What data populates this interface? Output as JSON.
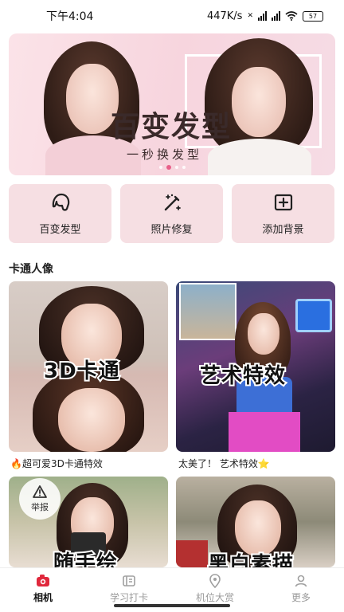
{
  "status_bar": {
    "time": "下午4:04",
    "net_speed": "447K/s",
    "battery": "57"
  },
  "banner": {
    "title": "百变发型",
    "subtitle": "一秒换发型",
    "dots": 4,
    "active_dot": 1
  },
  "quick_actions": [
    {
      "label": "百变发型",
      "icon": "hairstyle-icon"
    },
    {
      "label": "照片修复",
      "icon": "magic-wand-icon"
    },
    {
      "label": "添加背景",
      "icon": "add-square-icon"
    }
  ],
  "section": {
    "title": "卡通人像"
  },
  "cards": [
    {
      "tag": "3D卡通",
      "caption": "🔥超可爱3D卡通特效"
    },
    {
      "tag": "艺术特效",
      "caption": "太美了！ 艺术特效⭐"
    },
    {
      "tag": "随手绘",
      "caption": ""
    },
    {
      "tag": "黑白素描",
      "caption": ""
    }
  ],
  "report": {
    "label": "举报"
  },
  "bottom_nav": [
    {
      "label": "相机",
      "icon": "camera-icon",
      "active": true
    },
    {
      "label": "学习打卡",
      "icon": "book-icon",
      "active": false
    },
    {
      "label": "机位大赏",
      "icon": "location-pin-icon",
      "active": false
    },
    {
      "label": "更多",
      "icon": "user-icon",
      "active": false
    }
  ],
  "colors": {
    "accent": "#e8608a",
    "quick_bg": "#f6dfe3",
    "nav_active": "#e0283c"
  }
}
